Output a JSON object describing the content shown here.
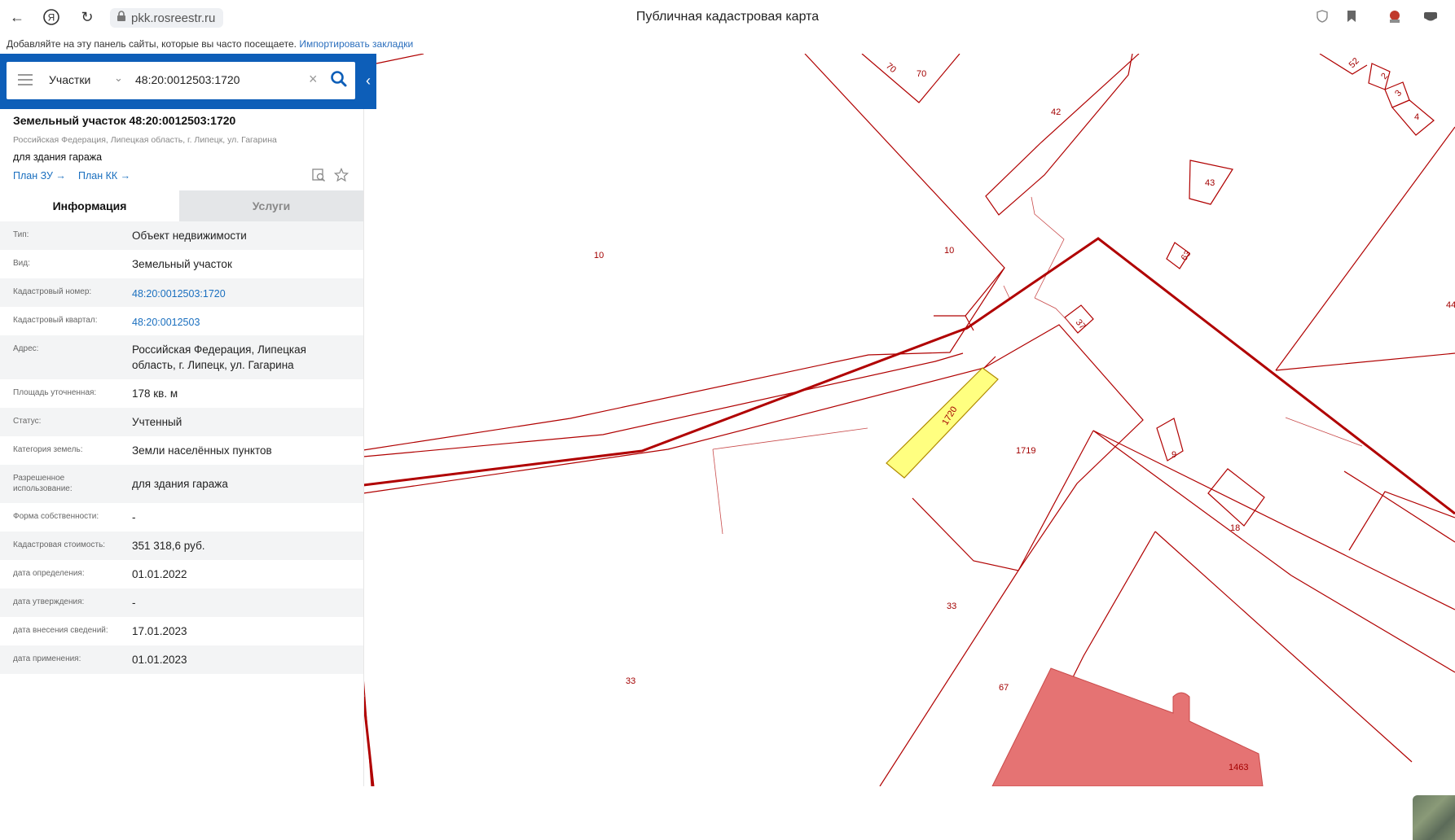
{
  "browser": {
    "url": "pkk.rosreestr.ru",
    "title": "Публичная кадастровая карта",
    "bookmarks_hint": "Добавляйте на эту панель сайты, которые вы часто посещаете.",
    "bookmarks_link": "Импортировать закладки"
  },
  "search": {
    "type": "Участки",
    "value": "48:20:0012503:1720"
  },
  "parcel": {
    "title": "Земельный участок 48:20:0012503:1720",
    "address": "Российская Федерация, Липецкая область, г. Липецк, ул. Гагарина",
    "use": "для здания гаража",
    "plan_zu": "План ЗУ →",
    "plan_kk": "План КК →"
  },
  "tabs": {
    "info": "Информация",
    "services": "Услуги"
  },
  "info_rows": [
    {
      "k": "Тип:",
      "v": "Объект недвижимости"
    },
    {
      "k": "Вид:",
      "v": "Земельный участок"
    },
    {
      "k": "Кадастровый номер:",
      "v": "48:20:0012503:1720"
    },
    {
      "k": "Кадастровый квартал:",
      "v": "48:20:0012503"
    },
    {
      "k": "Адрес:",
      "v": "Российская Федерация, Липецкая область, г. Липецк, ул. Гагарина"
    },
    {
      "k": "Площадь уточненная:",
      "v": "178 кв. м"
    },
    {
      "k": "Статус:",
      "v": "Учтенный"
    },
    {
      "k": "Категория земель:",
      "v": "Земли населённых пунктов"
    },
    {
      "k": "Разрешенное использование:",
      "v": "для здания гаража"
    },
    {
      "k": "Форма собственности:",
      "v": "-"
    },
    {
      "k": "Кадастровая стоимость:",
      "v": "351 318,6 руб."
    },
    {
      "k": "дата определения:",
      "v": "01.01.2022"
    },
    {
      "k": "дата утверждения:",
      "v": "-"
    },
    {
      "k": "дата внесения сведений:",
      "v": "17.01.2023"
    },
    {
      "k": "дата применения:",
      "v": "01.01.2023"
    }
  ],
  "map_labels": [
    "70",
    "70",
    "42",
    "43",
    "52",
    "2",
    "3",
    "4",
    "10",
    "10",
    "63",
    "37",
    "44",
    "1720",
    "1719",
    "9",
    "18",
    "33",
    "33",
    "67",
    "1463"
  ],
  "colors": {
    "boundary": "#b00000",
    "selected_fill": "#ffff80",
    "building_fill": "#e57373",
    "header_blue": "#0d5eb8"
  }
}
